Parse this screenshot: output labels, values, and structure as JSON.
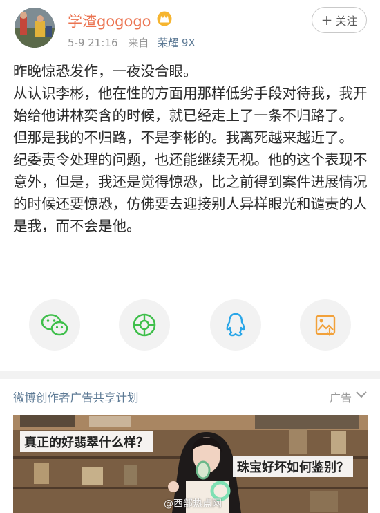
{
  "author": {
    "name": "学渣gogogo",
    "badge_icon": "crown-icon",
    "timestamp": "5-9 21:16",
    "source_prefix": "来自",
    "device": "荣耀 9X"
  },
  "follow": {
    "plus": "+",
    "label": "关注"
  },
  "post": {
    "paragraphs": [
      "昨晚惊恐发作，一夜没合眼。",
      "从认识李彬，他在性的方面用那样低劣手段对待我，我开始给他讲林奕含的时候，就已经走上了一条不归路了。",
      "但那是我的不归路，不是李彬的。我离死越来越近了。",
      "纪委责令处理的问题，也还能继续无视。他的这个表现不意外，但是，我还是觉得惊恐，比之前得到案件进展情况的时候还要惊恐，仿佛要去迎接别人异样眼光和谴责的人是我，而不会是他。"
    ]
  },
  "share": {
    "buttons": [
      "wechat-icon",
      "moments-icon",
      "qq-icon",
      "save-image-icon"
    ],
    "colors": {
      "wechat": "#3fbf4b",
      "moments": "#3fbf4b",
      "qq": "#2aa6e8",
      "save": "#f2a13a"
    }
  },
  "ad": {
    "title": "微博创作者广告共享计划",
    "label": "广告",
    "caption_left": "真正的好翡翠什么样？",
    "caption_right": "珠宝好坏如何鉴别？",
    "watermark": "@西部热点网"
  },
  "colors": {
    "username": "#eb7350",
    "link": "#5d7a95",
    "meta": "#939393"
  }
}
